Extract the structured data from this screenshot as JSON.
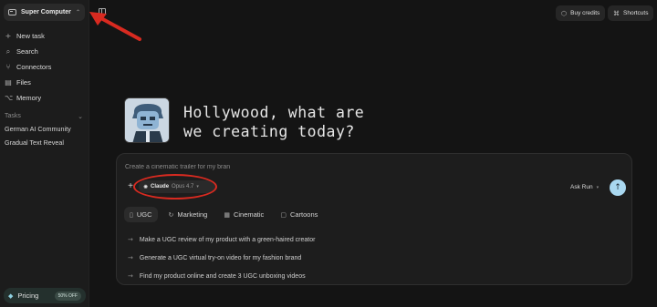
{
  "workspace": {
    "name": "Super Computer"
  },
  "sidebar": {
    "nav": [
      {
        "icon": "plus-icon",
        "glyph": "+",
        "label": "New task"
      },
      {
        "icon": "search-icon",
        "glyph": "⌕",
        "label": "Search"
      },
      {
        "icon": "connectors-icon",
        "glyph": "⑂",
        "label": "Connectors"
      },
      {
        "icon": "files-icon",
        "glyph": "▤",
        "label": "Files"
      },
      {
        "icon": "memory-icon",
        "glyph": "⌥",
        "label": "Memory"
      }
    ],
    "tasks_heading": "Tasks",
    "tasks": [
      "German AI Community",
      "Gradual Text Reveal"
    ],
    "pricing": {
      "label": "Pricing",
      "badge": "50% OFF"
    }
  },
  "topbar": {
    "buy_credits": "Buy credits",
    "shortcuts": "Shortcuts"
  },
  "hero": {
    "line1": "Hollywood, what are",
    "line2": "we creating today?"
  },
  "composer": {
    "placeholder": "Create a cinematic trailer for my bran",
    "model_name": "Claude",
    "model_version": "Opus 4.7",
    "run_mode": "Ask Run"
  },
  "tabs": [
    {
      "icon": "ugc-icon",
      "glyph": "▯",
      "label": "UGC",
      "active": true
    },
    {
      "icon": "marketing-icon",
      "glyph": "↻",
      "label": "Marketing"
    },
    {
      "icon": "cinematic-icon",
      "glyph": "▦",
      "label": "Cinematic"
    },
    {
      "icon": "cartoons-icon",
      "glyph": "▢",
      "label": "Cartoons"
    }
  ],
  "suggestions": [
    "Make a UGC review of my product with a green-haired creator",
    "Generate a UGC virtual try-on video for my fashion brand",
    "Find my product online and create 3 UGC unboxing videos"
  ],
  "colors": {
    "background": "#141414",
    "send_button": "#a9d8f0",
    "annotation": "#d82a20"
  }
}
